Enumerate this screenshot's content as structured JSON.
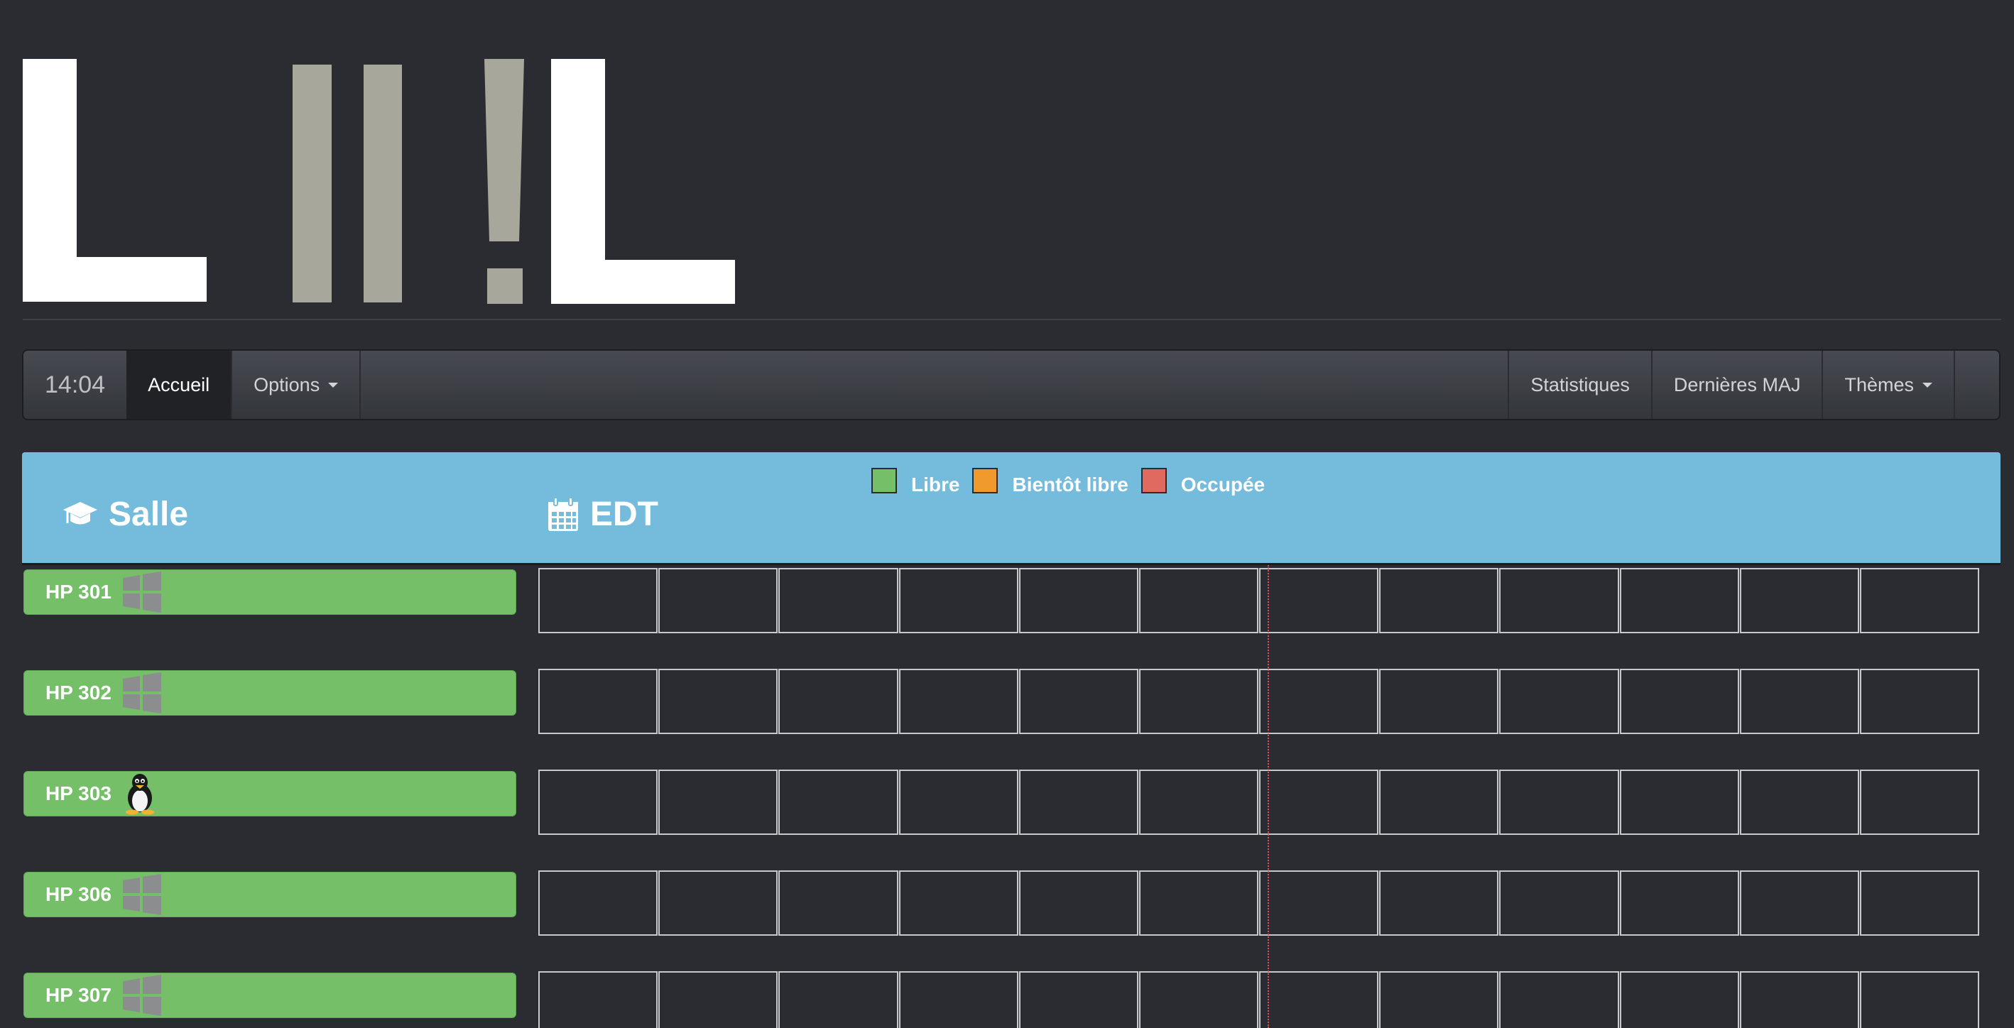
{
  "logo": {
    "text": "L!!!L",
    "colors": {
      "letters": "#ffffff",
      "bars": "#a8a79b"
    }
  },
  "navbar": {
    "clock": "14:04",
    "home_label": "Accueil",
    "options_label": "Options",
    "stats_label": "Statistiques",
    "updates_label": "Dernières MAJ",
    "themes_label": "Thèmes"
  },
  "header": {
    "room_title": "Salle",
    "room_icon": "graduation-cap-icon",
    "schedule_title": "EDT",
    "schedule_icon": "calendar-icon",
    "legend": [
      {
        "label": "Libre",
        "color": "#74bf68"
      },
      {
        "label": "Bientôt libre",
        "color": "#f09a2e"
      },
      {
        "label": "Occupée",
        "color": "#e06a60"
      }
    ]
  },
  "rooms": [
    {
      "name": "HP 301",
      "os": "windows-icon",
      "status": "Libre"
    },
    {
      "name": "HP 302",
      "os": "windows-icon",
      "status": "Libre"
    },
    {
      "name": "HP 303",
      "os": "linux-icon",
      "status": "Libre"
    },
    {
      "name": "HP 306",
      "os": "windows-icon",
      "status": "Libre"
    },
    {
      "name": "HP 307",
      "os": "windows-icon",
      "status": "Libre"
    }
  ],
  "schedule": {
    "slots_per_row": 12,
    "current_time_fraction": 0.506
  },
  "colors": {
    "background": "#2a2c31",
    "header": "#74bbdc",
    "free": "#74bf68",
    "now_line": "#e0504a"
  }
}
